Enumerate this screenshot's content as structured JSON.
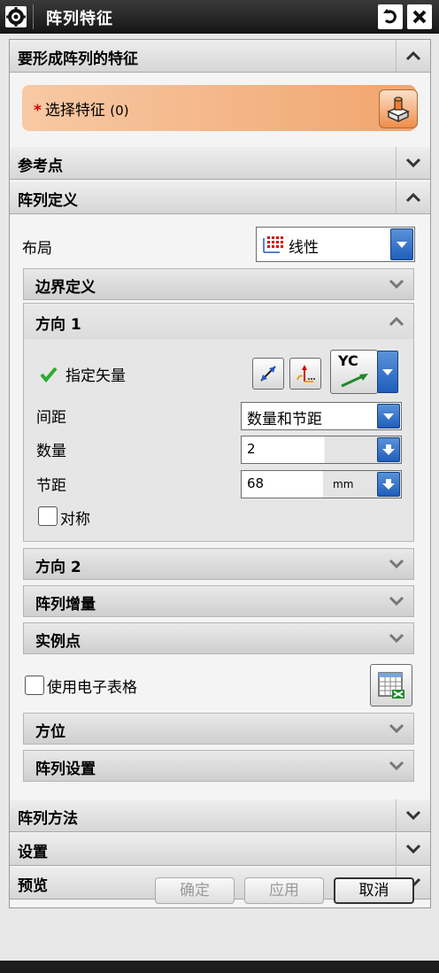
{
  "window": {
    "title": "阵列特征",
    "reset_icon": "reset-icon",
    "close_icon": "close-icon"
  },
  "sections": {
    "features_to_pattern": {
      "label": "要形成阵列的特征",
      "select_label": "选择特征",
      "select_required_mark": "*",
      "select_count": "(0)"
    },
    "reference_point": {
      "label": "参考点"
    },
    "pattern_definition": {
      "label": "阵列定义",
      "layout_label": "布局",
      "layout_value": "线性",
      "boundary_label": "边界定义",
      "direction1": {
        "label": "方向 1",
        "vector_label": "指定矢量",
        "vector_value": "YC",
        "spacing_label": "间距",
        "spacing_value": "数量和节距",
        "count_label": "数量",
        "count_value": "2",
        "pitch_label": "节距",
        "pitch_value": "68",
        "pitch_unit": "mm",
        "symmetric_label": "对称"
      },
      "direction2_label": "方向 2",
      "increment_label": "阵列增量",
      "instance_point_label": "实例点",
      "spreadsheet_label": "使用电子表格",
      "orientation_label": "方位",
      "pattern_settings_label": "阵列设置"
    },
    "pattern_method": {
      "label": "阵列方法"
    },
    "settings": {
      "label": "设置"
    },
    "preview": {
      "label": "预览"
    }
  },
  "footer": {
    "ok_label": "确定",
    "apply_label": "应用",
    "cancel_label": "取消"
  },
  "colors": {
    "accent": "#f1a56e",
    "dropdown_blue": "#1f5ebc",
    "check_green": "#2faa2f"
  }
}
